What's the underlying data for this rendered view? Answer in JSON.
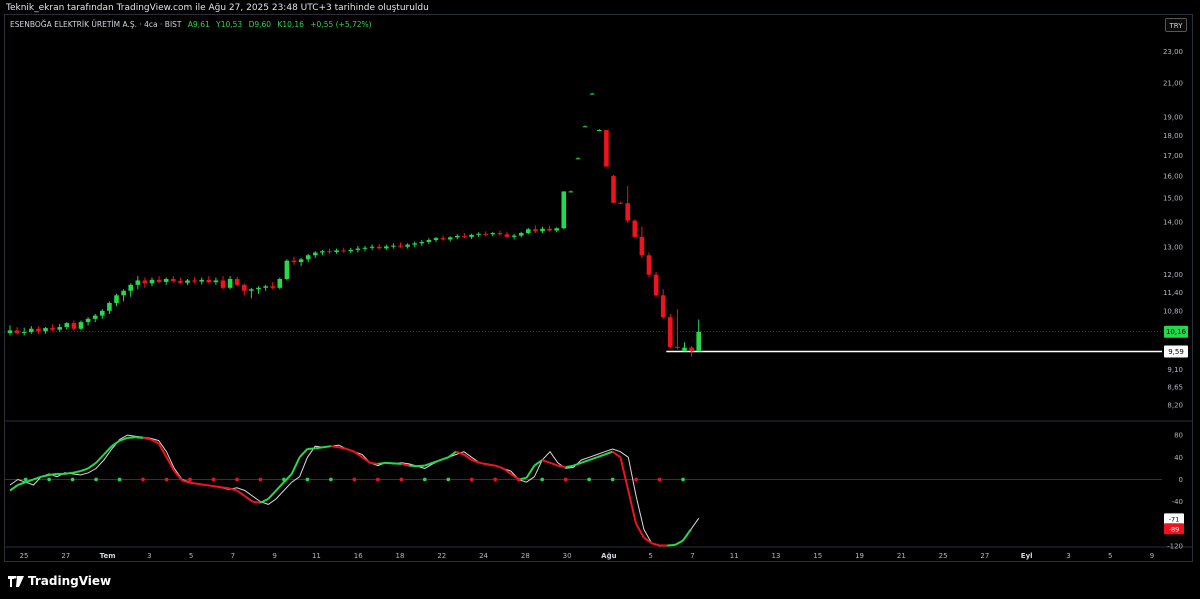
{
  "header": {
    "caption": "Teknik_ekran tarafından TradingView.com ile Ağu 27, 2025 23:48 UTC+3 tarihinde oluşturuldu"
  },
  "legend": {
    "symbol": "ESENBOĞA ELEKTRİK ÜRETİM A.Ş. · 4ca · BIST",
    "open": "A9,61",
    "high": "Y10,53",
    "low": "D9,60",
    "close": "K10,16",
    "change": "+0,55 (+5,72%)"
  },
  "toolbar": {
    "currency": "TRY"
  },
  "brand": {
    "name": "TradingView"
  },
  "colors": {
    "up": "#26d94a",
    "down": "#f0131e",
    "background": "#000000",
    "osc_line": "#d9d9d9",
    "osc_signal_up": "#26d94a",
    "osc_signal_down": "#f0131e",
    "zero_line": "#1d2f8a"
  },
  "chart_data": {
    "type": "candlestick",
    "price_axis": {
      "ticks": [
        "23,00",
        "21,00",
        "19,00",
        "18,00",
        "17,00",
        "16,00",
        "15,00",
        "14,00",
        "13,00",
        "12,00",
        "11,40",
        "10,80",
        "10,16",
        "9,59",
        "9,10",
        "8,65",
        "8,20"
      ],
      "scale": "log",
      "last_price_label": "10,16",
      "horizontal_line_label": "9,59",
      "horizontal_line_price": 9.59
    },
    "time_axis": {
      "ticks": [
        "25",
        "27",
        "Tem",
        "3",
        "5",
        "7",
        "9",
        "11",
        "16",
        "18",
        "22",
        "24",
        "28",
        "30",
        "Ağu",
        "5",
        "7",
        "11",
        "13",
        "15",
        "19",
        "21",
        "25",
        "27",
        "Eyl",
        "3",
        "5",
        "9"
      ]
    },
    "candles": [
      {
        "o": 10.12,
        "h": 10.35,
        "l": 10.05,
        "c": 10.2
      },
      {
        "o": 10.2,
        "h": 10.3,
        "l": 10.08,
        "c": 10.12
      },
      {
        "o": 10.12,
        "h": 10.28,
        "l": 10.05,
        "c": 10.15
      },
      {
        "o": 10.15,
        "h": 10.33,
        "l": 10.1,
        "c": 10.25
      },
      {
        "o": 10.25,
        "h": 10.32,
        "l": 10.1,
        "c": 10.18
      },
      {
        "o": 10.18,
        "h": 10.3,
        "l": 10.1,
        "c": 10.27
      },
      {
        "o": 10.27,
        "h": 10.38,
        "l": 10.18,
        "c": 10.22
      },
      {
        "o": 10.22,
        "h": 10.4,
        "l": 10.15,
        "c": 10.3
      },
      {
        "o": 10.3,
        "h": 10.45,
        "l": 10.22,
        "c": 10.42
      },
      {
        "o": 10.42,
        "h": 10.5,
        "l": 10.2,
        "c": 10.25
      },
      {
        "o": 10.25,
        "h": 10.5,
        "l": 10.2,
        "c": 10.45
      },
      {
        "o": 10.45,
        "h": 10.6,
        "l": 10.35,
        "c": 10.55
      },
      {
        "o": 10.55,
        "h": 10.7,
        "l": 10.45,
        "c": 10.65
      },
      {
        "o": 10.65,
        "h": 10.85,
        "l": 10.55,
        "c": 10.8
      },
      {
        "o": 10.8,
        "h": 11.1,
        "l": 10.7,
        "c": 11.05
      },
      {
        "o": 11.05,
        "h": 11.35,
        "l": 10.95,
        "c": 11.3
      },
      {
        "o": 11.3,
        "h": 11.5,
        "l": 11.1,
        "c": 11.45
      },
      {
        "o": 11.45,
        "h": 11.7,
        "l": 11.25,
        "c": 11.65
      },
      {
        "o": 11.65,
        "h": 11.95,
        "l": 11.5,
        "c": 11.8
      },
      {
        "o": 11.8,
        "h": 11.9,
        "l": 11.55,
        "c": 11.7
      },
      {
        "o": 11.7,
        "h": 11.9,
        "l": 11.6,
        "c": 11.82
      },
      {
        "o": 11.82,
        "h": 11.95,
        "l": 11.7,
        "c": 11.75
      },
      {
        "o": 11.75,
        "h": 11.9,
        "l": 11.65,
        "c": 11.85
      },
      {
        "o": 11.85,
        "h": 11.95,
        "l": 11.72,
        "c": 11.78
      },
      {
        "o": 11.78,
        "h": 11.9,
        "l": 11.68,
        "c": 11.72
      },
      {
        "o": 11.72,
        "h": 11.85,
        "l": 11.65,
        "c": 11.8
      },
      {
        "o": 11.8,
        "h": 11.92,
        "l": 11.7,
        "c": 11.76
      },
      {
        "o": 11.76,
        "h": 11.9,
        "l": 11.66,
        "c": 11.82
      },
      {
        "o": 11.82,
        "h": 11.95,
        "l": 11.7,
        "c": 11.74
      },
      {
        "o": 11.74,
        "h": 11.9,
        "l": 11.65,
        "c": 11.8
      },
      {
        "o": 11.8,
        "h": 11.95,
        "l": 11.5,
        "c": 11.55
      },
      {
        "o": 11.55,
        "h": 11.95,
        "l": 11.5,
        "c": 11.85
      },
      {
        "o": 11.85,
        "h": 11.92,
        "l": 11.6,
        "c": 11.65
      },
      {
        "o": 11.65,
        "h": 11.7,
        "l": 11.3,
        "c": 11.45
      },
      {
        "o": 11.45,
        "h": 11.55,
        "l": 11.2,
        "c": 11.5
      },
      {
        "o": 11.5,
        "h": 11.6,
        "l": 11.35,
        "c": 11.55
      },
      {
        "o": 11.55,
        "h": 11.65,
        "l": 11.45,
        "c": 11.6
      },
      {
        "o": 11.6,
        "h": 11.75,
        "l": 11.5,
        "c": 11.55
      },
      {
        "o": 11.55,
        "h": 11.9,
        "l": 11.5,
        "c": 11.85
      },
      {
        "o": 11.85,
        "h": 12.55,
        "l": 11.8,
        "c": 12.5
      },
      {
        "o": 12.5,
        "h": 12.65,
        "l": 12.35,
        "c": 12.45
      },
      {
        "o": 12.45,
        "h": 12.6,
        "l": 12.3,
        "c": 12.55
      },
      {
        "o": 12.55,
        "h": 12.75,
        "l": 12.45,
        "c": 12.7
      },
      {
        "o": 12.7,
        "h": 12.85,
        "l": 12.6,
        "c": 12.8
      },
      {
        "o": 12.8,
        "h": 12.9,
        "l": 12.7,
        "c": 12.85
      },
      {
        "o": 12.85,
        "h": 12.95,
        "l": 12.75,
        "c": 12.82
      },
      {
        "o": 12.82,
        "h": 12.95,
        "l": 12.75,
        "c": 12.88
      },
      {
        "o": 12.88,
        "h": 12.98,
        "l": 12.8,
        "c": 12.85
      },
      {
        "o": 12.85,
        "h": 12.98,
        "l": 12.78,
        "c": 12.9
      },
      {
        "o": 12.9,
        "h": 13.05,
        "l": 12.8,
        "c": 12.95
      },
      {
        "o": 12.95,
        "h": 13.05,
        "l": 12.85,
        "c": 12.98
      },
      {
        "o": 12.98,
        "h": 13.1,
        "l": 12.9,
        "c": 13.02
      },
      {
        "o": 13.02,
        "h": 13.12,
        "l": 12.92,
        "c": 12.96
      },
      {
        "o": 12.96,
        "h": 13.1,
        "l": 12.9,
        "c": 13.03
      },
      {
        "o": 13.03,
        "h": 13.15,
        "l": 12.95,
        "c": 13.06
      },
      {
        "o": 13.06,
        "h": 13.18,
        "l": 12.98,
        "c": 13.02
      },
      {
        "o": 13.02,
        "h": 13.15,
        "l": 12.95,
        "c": 13.1
      },
      {
        "o": 13.1,
        "h": 13.22,
        "l": 13.0,
        "c": 13.15
      },
      {
        "o": 13.15,
        "h": 13.28,
        "l": 13.05,
        "c": 13.2
      },
      {
        "o": 13.2,
        "h": 13.35,
        "l": 13.12,
        "c": 13.28
      },
      {
        "o": 13.28,
        "h": 13.4,
        "l": 13.2,
        "c": 13.35
      },
      {
        "o": 13.35,
        "h": 13.45,
        "l": 13.25,
        "c": 13.3
      },
      {
        "o": 13.3,
        "h": 13.42,
        "l": 13.22,
        "c": 13.38
      },
      {
        "o": 13.38,
        "h": 13.5,
        "l": 13.3,
        "c": 13.44
      },
      {
        "o": 13.44,
        "h": 13.55,
        "l": 13.35,
        "c": 13.4
      },
      {
        "o": 13.4,
        "h": 13.52,
        "l": 13.32,
        "c": 13.48
      },
      {
        "o": 13.48,
        "h": 13.58,
        "l": 13.4,
        "c": 13.52
      },
      {
        "o": 13.52,
        "h": 13.62,
        "l": 13.42,
        "c": 13.5
      },
      {
        "o": 13.5,
        "h": 13.6,
        "l": 13.42,
        "c": 13.55
      },
      {
        "o": 13.55,
        "h": 13.65,
        "l": 13.45,
        "c": 13.5
      },
      {
        "o": 13.5,
        "h": 13.6,
        "l": 13.35,
        "c": 13.4
      },
      {
        "o": 13.4,
        "h": 13.52,
        "l": 13.3,
        "c": 13.45
      },
      {
        "o": 13.45,
        "h": 13.6,
        "l": 13.38,
        "c": 13.55
      },
      {
        "o": 13.55,
        "h": 13.75,
        "l": 13.5,
        "c": 13.7
      },
      {
        "o": 13.7,
        "h": 13.85,
        "l": 13.55,
        "c": 13.62
      },
      {
        "o": 13.62,
        "h": 13.8,
        "l": 13.55,
        "c": 13.72
      },
      {
        "o": 13.72,
        "h": 13.85,
        "l": 13.6,
        "c": 13.65
      },
      {
        "o": 13.65,
        "h": 13.78,
        "l": 13.58,
        "c": 13.74
      },
      {
        "o": 13.74,
        "h": 15.3,
        "l": 13.7,
        "c": 15.3
      },
      {
        "o": 15.3,
        "h": 15.35,
        "l": 15.3,
        "c": 15.3
      },
      {
        "o": 16.85,
        "h": 16.9,
        "l": 16.85,
        "c": 16.85
      },
      {
        "o": 18.5,
        "h": 18.55,
        "l": 18.5,
        "c": 18.5
      },
      {
        "o": 20.35,
        "h": 20.4,
        "l": 20.35,
        "c": 20.35
      },
      {
        "o": 18.3,
        "h": 18.35,
        "l": 18.3,
        "c": 18.3
      },
      {
        "o": 18.3,
        "h": 18.3,
        "l": 16.45,
        "c": 16.45
      },
      {
        "o": 16.0,
        "h": 16.05,
        "l": 14.8,
        "c": 14.8
      },
      {
        "o": 14.8,
        "h": 14.85,
        "l": 14.75,
        "c": 14.78
      },
      {
        "o": 14.78,
        "h": 15.55,
        "l": 13.95,
        "c": 14.05
      },
      {
        "o": 14.05,
        "h": 14.1,
        "l": 13.35,
        "c": 13.4
      },
      {
        "o": 13.4,
        "h": 13.8,
        "l": 12.6,
        "c": 12.7
      },
      {
        "o": 12.7,
        "h": 12.8,
        "l": 11.9,
        "c": 12.0
      },
      {
        "o": 12.0,
        "h": 12.1,
        "l": 11.25,
        "c": 11.3
      },
      {
        "o": 11.3,
        "h": 11.5,
        "l": 10.55,
        "c": 10.6
      },
      {
        "o": 10.6,
        "h": 10.7,
        "l": 9.68,
        "c": 9.72
      },
      {
        "o": 9.72,
        "h": 10.85,
        "l": 9.65,
        "c": 9.7
      },
      {
        "o": 9.61,
        "h": 9.85,
        "l": 9.6,
        "c": 9.7
      },
      {
        "o": 9.7,
        "h": 9.75,
        "l": 9.45,
        "c": 9.6
      },
      {
        "o": 9.61,
        "h": 10.53,
        "l": 9.6,
        "c": 10.16
      }
    ],
    "oscillator": {
      "axis_ticks": [
        "80",
        "40",
        "0",
        "-40",
        "-71",
        "-89",
        "-120"
      ],
      "last_values": [
        "-71",
        "-89"
      ],
      "range": [
        -120,
        100
      ],
      "line": [
        -10,
        0,
        -5,
        -10,
        5,
        10,
        5,
        12,
        10,
        8,
        12,
        20,
        35,
        55,
        72,
        80,
        78,
        76,
        74,
        70,
        50,
        20,
        0,
        -5,
        -8,
        -10,
        -12,
        -15,
        -18,
        -15,
        -20,
        -30,
        -40,
        -45,
        -35,
        -20,
        -5,
        5,
        40,
        60,
        58,
        60,
        62,
        55,
        50,
        45,
        30,
        25,
        30,
        28,
        30,
        28,
        24,
        20,
        28,
        35,
        40,
        45,
        50,
        40,
        30,
        28,
        25,
        20,
        15,
        0,
        -5,
        5,
        35,
        50,
        30,
        20,
        22,
        35,
        40,
        45,
        50,
        55,
        50,
        40,
        -30,
        -90,
        -115,
        -120,
        -119,
        -118,
        -110,
        -90,
        -70
      ],
      "signal": [
        -20,
        -10,
        -5,
        0,
        5,
        8,
        10,
        10,
        12,
        15,
        20,
        30,
        45,
        60,
        70,
        75,
        76,
        75,
        72,
        65,
        40,
        15,
        -2,
        -6,
        -8,
        -10,
        -12,
        -14,
        -16,
        -20,
        -30,
        -40,
        -42,
        -35,
        -20,
        -5,
        10,
        40,
        55,
        56,
        58,
        60,
        58,
        55,
        50,
        40,
        30,
        28,
        30,
        29,
        28,
        25,
        24,
        25,
        30,
        35,
        40,
        50,
        45,
        35,
        30,
        27,
        25,
        20,
        10,
        0,
        3,
        25,
        35,
        30,
        25,
        22,
        25,
        30,
        35,
        40,
        45,
        50,
        40,
        -20,
        -80,
        -105,
        -115,
        -119,
        -119,
        -118,
        -110,
        -90
      ]
    }
  }
}
